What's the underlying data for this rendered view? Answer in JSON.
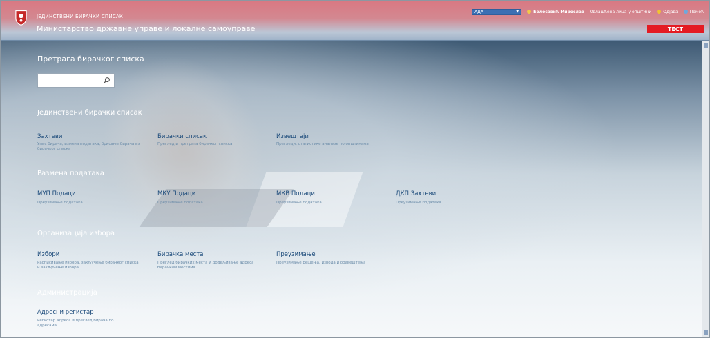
{
  "header": {
    "subtitle": "ЈЕДИНСТВЕНИ БИРАЧКИ СПИСАК",
    "title": "Министарство државне управе и локалне самоуправе",
    "select_value": "АДА",
    "user": "Белосавић Мирослав",
    "link1": "Овлашћена лица у општини",
    "logout": "Одјава",
    "help": "Помоћ",
    "badge": "ТЕСТ"
  },
  "search": {
    "title": "Претрага бирачког списка",
    "placeholder": ""
  },
  "sections": {
    "jbs": {
      "title": "Јединствени бирачки списак",
      "items": [
        {
          "label": "Захтеви",
          "desc": "Упис бирача, измена података, брисање бирача из бирачког списка"
        },
        {
          "label": "Бирачки списак",
          "desc": "Преглед и претрага бирачког списка"
        },
        {
          "label": "Извештаји",
          "desc": "Прегледи, статистике анализе по општинама"
        }
      ]
    },
    "exchange": {
      "title": "Размена података",
      "items": [
        {
          "label": "МУП Подаци",
          "desc": "Преузимање података"
        },
        {
          "label": "МКУ Подаци",
          "desc": "Преузимање података"
        },
        {
          "label": "МКВ Подаци",
          "desc": "Преузимање података"
        },
        {
          "label": "ДКП Захтеви",
          "desc": "Преузимање података"
        }
      ]
    },
    "elections": {
      "title": "Организација избора",
      "items": [
        {
          "label": "Избори",
          "desc": "Расписивање избора, закључење бирачког списка и закључење избора"
        },
        {
          "label": "Бирачка места",
          "desc": "Преглед бирачких места и додељивање адреса бирачким местима"
        },
        {
          "label": "Преузимање",
          "desc": "Преузимање решења, извода и обавештења"
        }
      ]
    },
    "admin": {
      "title": "Администрација",
      "items": [
        {
          "label": "Адресни регистар",
          "desc": "Регистар адреса и преглед бирача по адресама"
        }
      ]
    }
  },
  "colors": {
    "header_red": "#d97882",
    "badge_red": "#e41b23",
    "link_blue": "#1b4a7a",
    "desc_blue": "#6b8ca9"
  }
}
